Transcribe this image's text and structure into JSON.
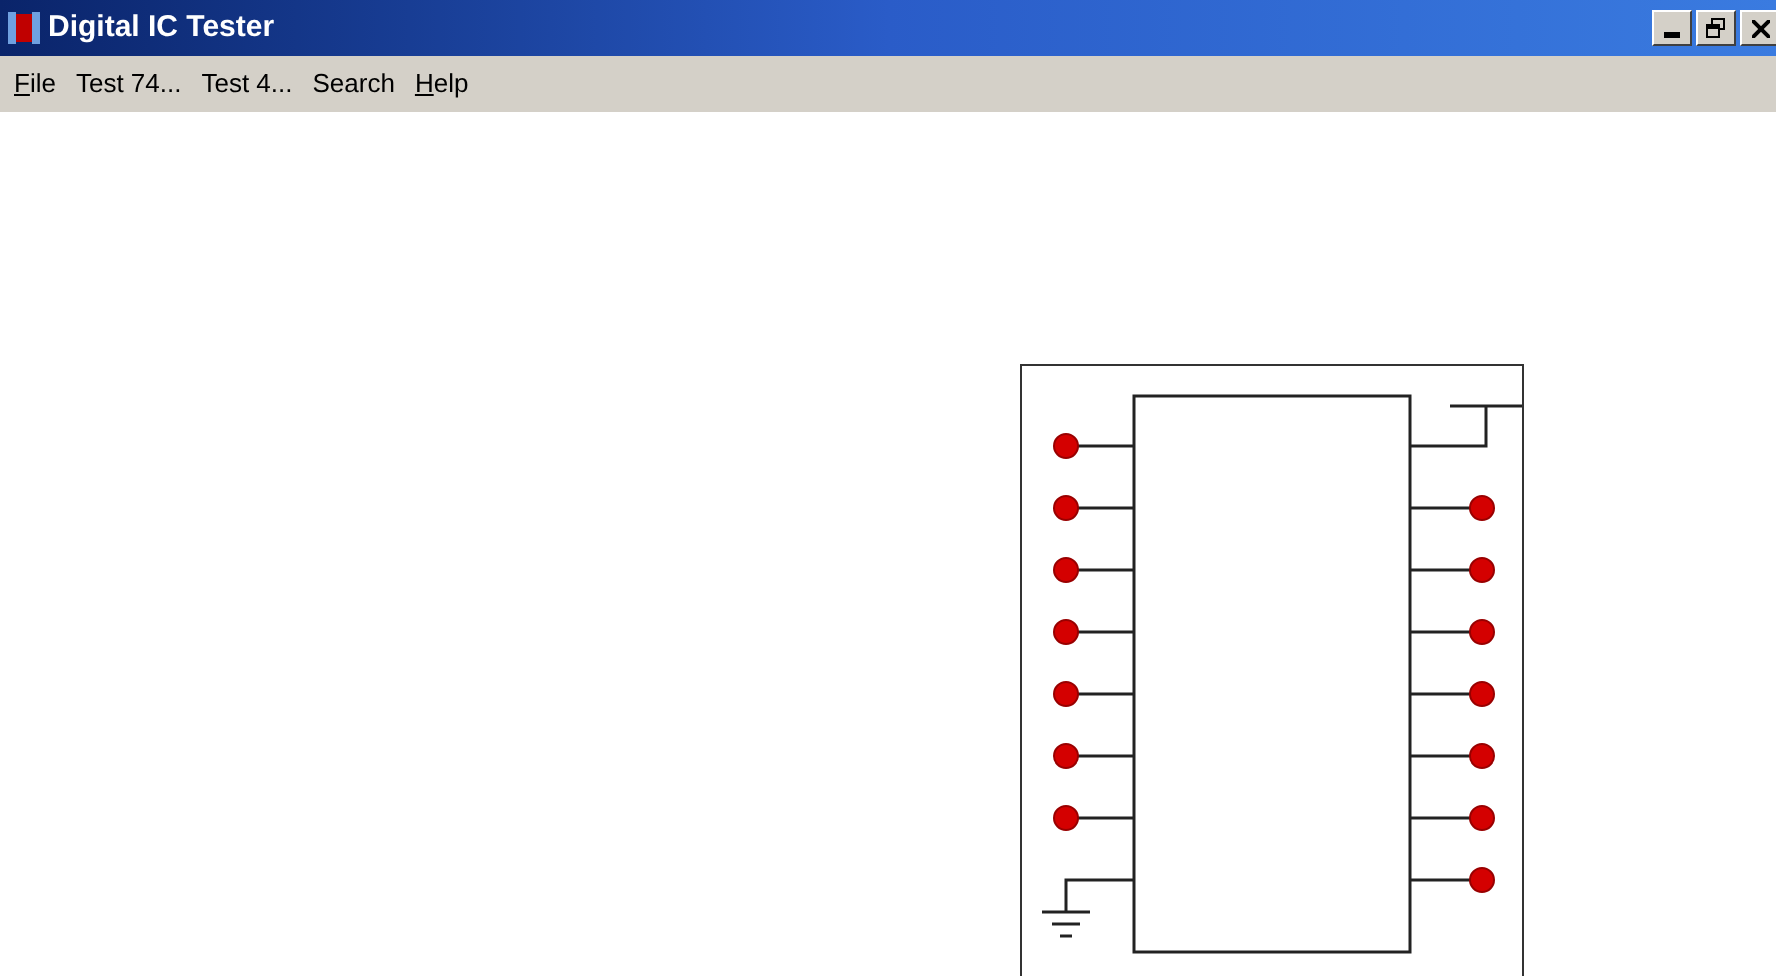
{
  "window": {
    "title": "Digital IC Tester"
  },
  "menu": [
    {
      "label": "File",
      "mnemonic": true
    },
    {
      "label": "Test 74...",
      "mnemonic": false
    },
    {
      "label": "Test 4...",
      "mnemonic": false
    },
    {
      "label": "Search",
      "mnemonic": false
    },
    {
      "label": "Help",
      "mnemonic": true
    }
  ],
  "chip": {
    "left_pins": [
      {
        "kind": "led",
        "on": true
      },
      {
        "kind": "led",
        "on": true
      },
      {
        "kind": "led",
        "on": true
      },
      {
        "kind": "led",
        "on": true
      },
      {
        "kind": "led",
        "on": true
      },
      {
        "kind": "led",
        "on": true
      },
      {
        "kind": "led",
        "on": true
      },
      {
        "kind": "ground"
      }
    ],
    "right_pins": [
      {
        "kind": "vcc"
      },
      {
        "kind": "led",
        "on": true
      },
      {
        "kind": "led",
        "on": true
      },
      {
        "kind": "led",
        "on": true
      },
      {
        "kind": "led",
        "on": true
      },
      {
        "kind": "led",
        "on": true
      },
      {
        "kind": "led",
        "on": true
      },
      {
        "kind": "led",
        "on": true
      }
    ]
  }
}
